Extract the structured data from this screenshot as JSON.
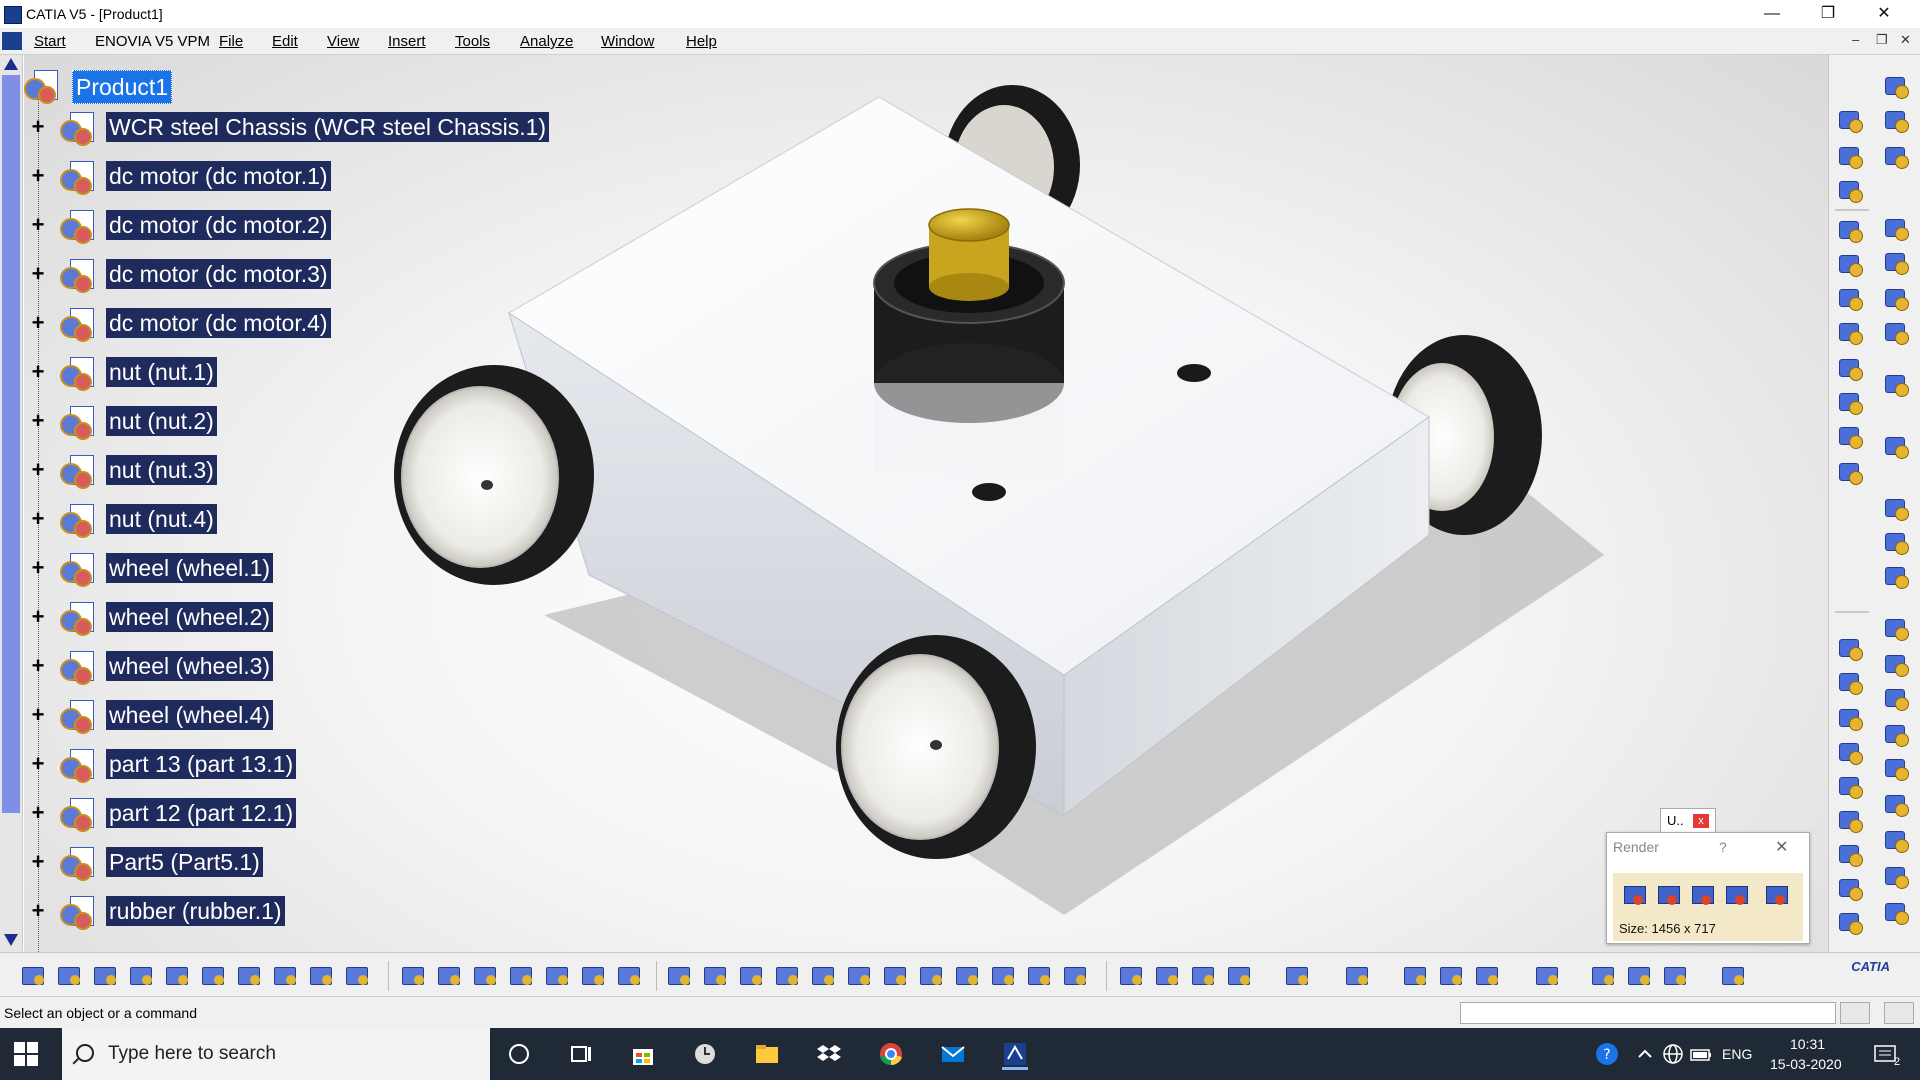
{
  "window": {
    "title": "CATIA V5 - [Product1]",
    "minimize": "—",
    "restore": "❐",
    "close": "✕"
  },
  "menu": {
    "items": [
      "Start",
      "ENOVIA V5 VPM",
      "File",
      "Edit",
      "View",
      "Insert",
      "Tools",
      "Analyze",
      "Window",
      "Help"
    ],
    "doc_controls": [
      "–",
      "❐",
      "✕"
    ]
  },
  "tree": {
    "root": "Product1",
    "nodes": [
      "WCR steel Chassis (WCR steel Chassis.1)",
      "dc motor (dc motor.1)",
      "dc motor (dc motor.2)",
      "dc motor (dc motor.3)",
      "dc motor (dc motor.4)",
      "nut (nut.1)",
      "nut (nut.2)",
      "nut (nut.3)",
      "nut (nut.4)",
      "wheel (wheel.1)",
      "wheel (wheel.2)",
      "wheel (wheel.3)",
      "wheel (wheel.4)",
      "part 13 (part 13.1)",
      "part 12 (part 12.1)",
      "Part5 (Part5.1)",
      "rubber (rubber.1)"
    ]
  },
  "render_panel": {
    "title": "Render",
    "help": "?",
    "close": "✕",
    "size_text": "Size: 1456 x 717",
    "tab_label": "U..",
    "tab_close": "x"
  },
  "bottom_toolbar": {
    "logo": "CATIA"
  },
  "status": {
    "message": "Select an object or a command"
  },
  "taskbar": {
    "search_placeholder": "Type here to search",
    "language": "ENG",
    "time": "10:31",
    "date": "15-03-2020",
    "notification_count": "2"
  },
  "colors": {
    "tree_selected_bg": "#1a74e8",
    "tree_label_bg": "#1e2b5c",
    "scroll_thumb": "#7f8fe8",
    "taskbar_bg": "#1f2a36"
  }
}
